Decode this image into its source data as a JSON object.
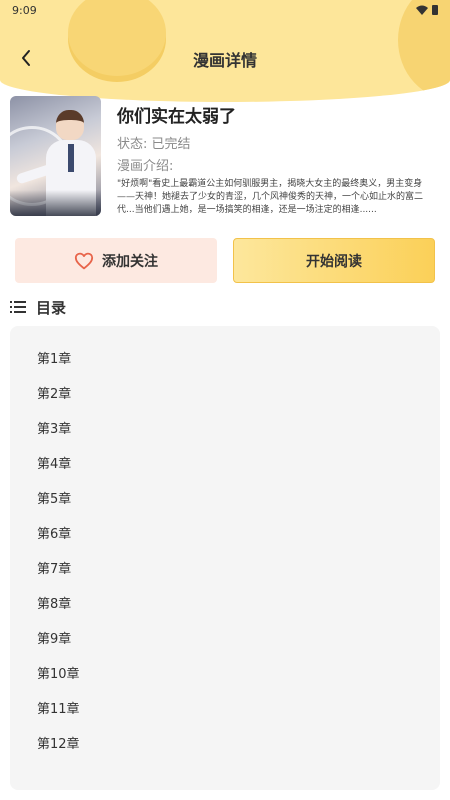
{
  "status_bar": {
    "time": "9:09",
    "icons": [
      "wifi-icon",
      "battery-icon"
    ]
  },
  "nav": {
    "title": "漫画详情",
    "back_icon": "chevron-left-icon"
  },
  "comic": {
    "title": "你们实在太弱了",
    "status_line": "状态: 已完结",
    "intro_label": "漫画介绍:",
    "description": "\"好烦啊\"看史上最霸道公主如何驯服男主，揭晓大女主的最终奥义，男主变身——天神！她褪去了少女的青涩，几个风神俊秀的天神，一个心如止水的富二代...当他们遇上她，是一场搞笑的相逢，还是一场注定的相逢......"
  },
  "actions": {
    "follow_label": "添加关注",
    "follow_icon": "heart-outline-icon",
    "read_label": "开始阅读"
  },
  "toc": {
    "title": "目录",
    "icon": "list-icon",
    "chapters": [
      "第1章",
      "第2章",
      "第3章",
      "第4章",
      "第5章",
      "第6章",
      "第7章",
      "第8章",
      "第9章",
      "第10章",
      "第11章",
      "第12章"
    ]
  },
  "colors": {
    "header_bg": "#fde69a",
    "accent": "#fbd058",
    "heart": "#e8644a",
    "follow_bg": "#fde9e1"
  }
}
